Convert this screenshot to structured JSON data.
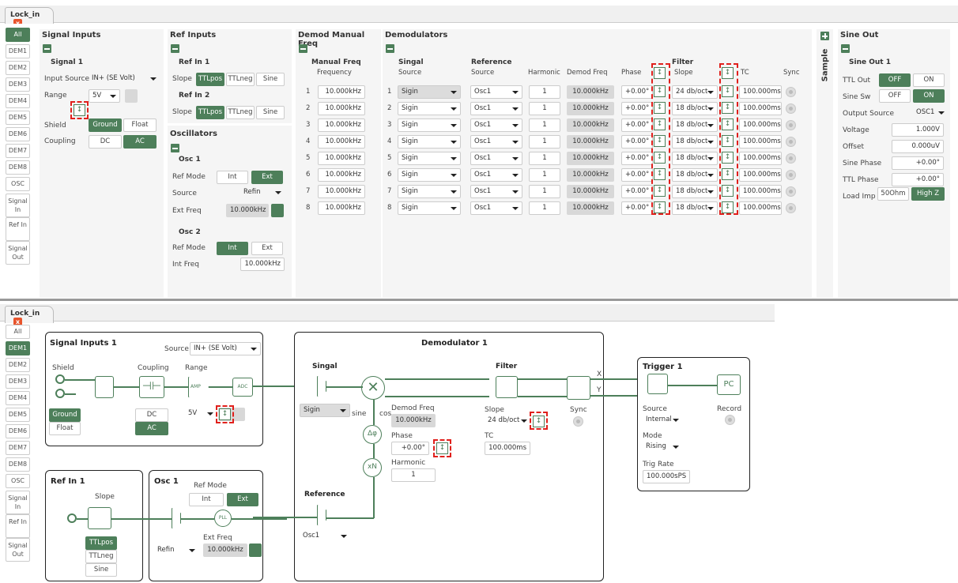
{
  "top": {
    "tab_label": "Lock_in",
    "tab_close": "x",
    "nav": [
      "All",
      "DEM1",
      "DEM2",
      "DEM3",
      "DEM4",
      "DEM5",
      "DEM6",
      "DEM7",
      "DEM8",
      "OSC",
      "Signal In",
      "Ref In",
      "Signal Out"
    ],
    "signal_inputs": {
      "title": "Signal Inputs",
      "sub": "Signal 1",
      "input_source_label": "Input Source",
      "input_source": "IN+ (SE Volt)",
      "range_label": "Range",
      "range": "5V",
      "shield_label": "Shield",
      "ground": "Ground",
      "float": "Float",
      "coupling_label": "Coupling",
      "dc": "DC",
      "ac": "AC"
    },
    "ref_inputs": {
      "title": "Ref Inputs",
      "ref1": "Ref In 1",
      "ref2": "Ref In 2",
      "slope_label": "Slope",
      "ttlpos": "TTLpos",
      "ttlneg": "TTLneg",
      "sine": "Sine"
    },
    "oscillators": {
      "title": "Oscillators",
      "osc1": "Osc 1",
      "ref_mode_label": "Ref Mode",
      "int": "Int",
      "ext": "Ext",
      "source_label": "Source",
      "source": "Refin",
      "ext_freq_label": "Ext Freq",
      "ext_freq": "10.000kHz",
      "osc2": "Osc 2",
      "int_freq_label": "Int Freq",
      "int_freq": "10.000kHz"
    },
    "manual": {
      "title": "Demod Manual Freq",
      "sub": "Manual Freq",
      "col": "Frequency",
      "rows": [
        "10.000kHz",
        "10.000kHz",
        "10.000kHz",
        "10.000kHz",
        "10.000kHz",
        "10.000kHz",
        "10.000kHz",
        "10.000kHz"
      ]
    },
    "demods": {
      "title": "Demodulators",
      "singal": "Singal",
      "source_col": "Source",
      "reference": "Reference",
      "ref_source_col": "Source",
      "harmonic_col": "Harmonic",
      "demod_freq_col": "Demod Freq",
      "phase_col": "Phase",
      "filter": "Filter",
      "slope_col": "Slope",
      "tc_col": "TC",
      "sync_col": "Sync",
      "rows": [
        {
          "n": "1",
          "sig": "Sigin",
          "ref": "Osc1",
          "harm": "1",
          "freq": "10.000kHz",
          "phase": "+0.00°",
          "slope": "24 db/oct",
          "tc": "100.000ms"
        },
        {
          "n": "2",
          "sig": "Sigin",
          "ref": "Osc1",
          "harm": "1",
          "freq": "10.000kHz",
          "phase": "+0.00°",
          "slope": "18 db/oct",
          "tc": "100.000ms"
        },
        {
          "n": "3",
          "sig": "Sigin",
          "ref": "Osc1",
          "harm": "1",
          "freq": "10.000kHz",
          "phase": "+0.00°",
          "slope": "18 db/oct",
          "tc": "100.000ms"
        },
        {
          "n": "4",
          "sig": "Sigin",
          "ref": "Osc1",
          "harm": "1",
          "freq": "10.000kHz",
          "phase": "+0.00°",
          "slope": "18 db/oct",
          "tc": "100.000ms"
        },
        {
          "n": "5",
          "sig": "Sigin",
          "ref": "Osc1",
          "harm": "1",
          "freq": "10.000kHz",
          "phase": "+0.00°",
          "slope": "18 db/oct",
          "tc": "100.000ms"
        },
        {
          "n": "6",
          "sig": "Sigin",
          "ref": "Osc1",
          "harm": "1",
          "freq": "10.000kHz",
          "phase": "+0.00°",
          "slope": "18 db/oct",
          "tc": "100.000ms"
        },
        {
          "n": "7",
          "sig": "Sigin",
          "ref": "Osc1",
          "harm": "1",
          "freq": "10.000kHz",
          "phase": "+0.00°",
          "slope": "18 db/oct",
          "tc": "100.000ms"
        },
        {
          "n": "8",
          "sig": "Sigin",
          "ref": "Osc1",
          "harm": "1",
          "freq": "10.000kHz",
          "phase": "+0.00°",
          "slope": "18 db/oct",
          "tc": "100.000ms"
        }
      ]
    },
    "sample": "Sample",
    "sine_out": {
      "title": "Sine Out",
      "sub": "Sine Out 1",
      "ttl_out_label": "TTL Out",
      "off": "OFF",
      "on": "ON",
      "sine_sw_label": "Sine Sw",
      "output_source_label": "Output Source",
      "output_source": "OSC1",
      "voltage_label": "Voltage",
      "voltage": "1.000V",
      "offset_label": "Offset",
      "offset": "0.000uV",
      "sine_phase_label": "Sine Phase",
      "sine_phase": "+0.00°",
      "ttl_phase_label": "TTL Phase",
      "ttl_phase": "+0.00°",
      "load_label": "Load Imp",
      "load_50": "50Ohm",
      "load_hz": "High Z"
    }
  },
  "bottom": {
    "tab_label": "Lock_in",
    "tab_close": "x",
    "nav": [
      "All",
      "DEM1",
      "DEM2",
      "DEM3",
      "DEM4",
      "DEM5",
      "DEM6",
      "DEM7",
      "DEM8",
      "OSC",
      "Signal In",
      "Ref In",
      "Signal Out"
    ],
    "si": {
      "title": "Signal Inputs 1",
      "source_label": "Source",
      "source": "IN+ (SE Volt)",
      "shield": "Shield",
      "coupling": "Coupling",
      "range": "Range",
      "ground": "Ground",
      "float": "Float",
      "dc": "DC",
      "ac": "AC",
      "range_val": "5V",
      "amp": "AMP",
      "adc": "ADC"
    },
    "demod": {
      "title": "Demodulator 1",
      "singal": "Singal",
      "sig": "Sigin",
      "sine": "sine",
      "cos": "cos",
      "demod_freq_label": "Demod Freq",
      "demod_freq": "10.000kHz",
      "phase_label": "Phase",
      "phase": "+0.00°",
      "harmonic_label": "Harmonic",
      "harmonic": "1",
      "filter": "Filter",
      "slope_label": "Slope",
      "slope": "24 db/oct",
      "tc_label": "TC",
      "tc": "100.000ms",
      "sync": "Sync",
      "x": "X",
      "y": "Y",
      "reference": "Reference",
      "ref": "Osc1",
      "dphi": "Δφ",
      "xn": "xN"
    },
    "trig": {
      "title": "Trigger 1",
      "pc": "PC",
      "source_label": "Source",
      "source": "Internal",
      "record": "Record",
      "mode_label": "Mode",
      "mode": "Rising",
      "rate_label": "Trig Rate",
      "rate": "100.000sPS"
    },
    "ref": {
      "title": "Ref In 1",
      "slope": "Slope",
      "ttlpos": "TTLpos",
      "ttlneg": "TTLneg",
      "sine": "Sine"
    },
    "osc": {
      "title": "Osc 1",
      "ref_mode": "Ref Mode",
      "int": "Int",
      "ext": "Ext",
      "pll": "PLL",
      "ext_freq_label": "Ext Freq",
      "src": "Refin",
      "ext_freq": "10.000kHz"
    }
  },
  "colors": {
    "accent": "#4d7f5a",
    "highlight": "#e0201c"
  }
}
